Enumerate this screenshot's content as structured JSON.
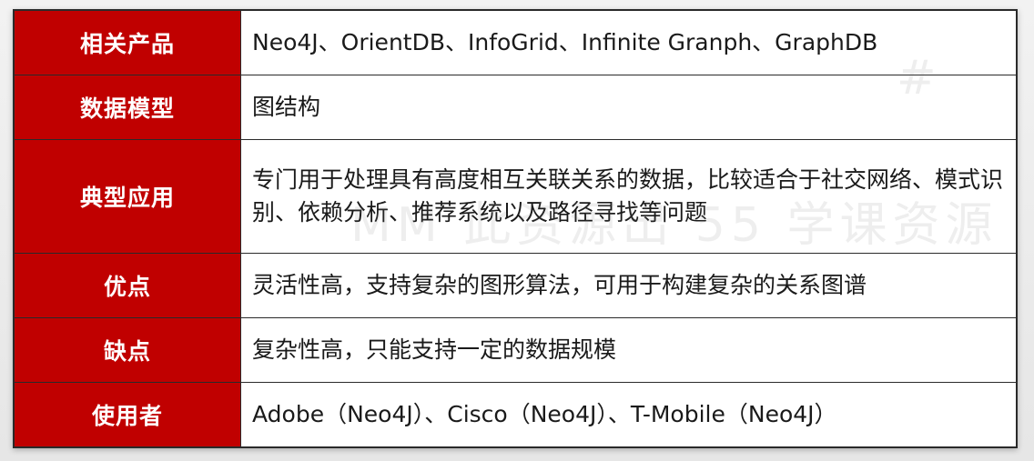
{
  "table": {
    "rows": [
      {
        "label": "相关产品",
        "value": "Neo4J、OrientDB、InfoGrid、Infinite Granph、GraphDB"
      },
      {
        "label": "数据模型",
        "value": "图结构"
      },
      {
        "label": "典型应用",
        "value": "专门用于处理具有高度相互关联关系的数据，比较适合于社交网络、模式识别、依赖分析、推荐系统以及路径寻找等问题"
      },
      {
        "label": "优点",
        "value": "灵活性高，支持复杂的图形算法，可用于构建复杂的关系图谱"
      },
      {
        "label": "缺点",
        "value": "复杂性高，只能支持一定的数据规模"
      },
      {
        "label": "使用者",
        "value": "Adobe（Neo4J）、Cisco（Neo4J）、T-Mobile（Neo4J）"
      }
    ]
  },
  "watermark": {
    "main": "MM 此资源出 55 学课资源",
    "hash": "#"
  }
}
